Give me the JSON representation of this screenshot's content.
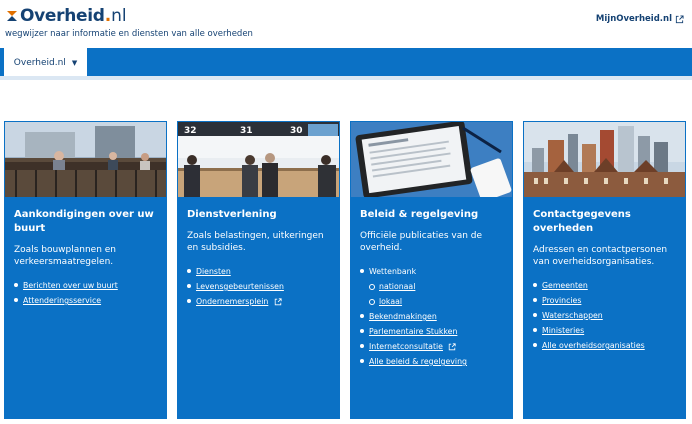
{
  "header": {
    "logo_name": "Overheid",
    "logo_dot": ".",
    "logo_tld": "nl",
    "tagline": "wegwijzer naar informatie en diensten van alle overheden",
    "mijn_link": "MijnOverheid.nl"
  },
  "nav": {
    "tab_label": "Overheid.nl"
  },
  "colors": {
    "brand_blue": "#154273",
    "accent_blue": "#0b71c5",
    "logo_orange": "#e17000"
  },
  "cards": [
    {
      "title": "Aankondigingen over uw buurt",
      "description": "Zoals bouwplannen en verkeersmaatregelen.",
      "links": [
        {
          "label": "Berichten over uw buurt"
        },
        {
          "label": "Attenderingsservice"
        }
      ]
    },
    {
      "title": "Dienstverlening",
      "description": "Zoals belastingen, uitkeringen en subsidies.",
      "links": [
        {
          "label": "Diensten"
        },
        {
          "label": "Levensgebeurtenissen"
        },
        {
          "label": "Ondernemersplein",
          "external": true
        }
      ]
    },
    {
      "title": "Beleid & regelgeving",
      "description": "Officiële publicaties van de overheid.",
      "links": [
        {
          "label": "Wettenbank"
        },
        {
          "label": "nationaal",
          "sub": true
        },
        {
          "label": "lokaal",
          "sub": true
        },
        {
          "label": "Bekendmakingen"
        },
        {
          "label": "Parlementaire Stukken"
        },
        {
          "label": "Internetconsultatie",
          "external": true
        },
        {
          "label": "Alle beleid & regelgeving"
        }
      ]
    },
    {
      "title": "Contactgegevens overheden",
      "description": "Adressen en contactpersonen van overheidsorganisaties.",
      "links": [
        {
          "label": "Gemeenten"
        },
        {
          "label": "Provincies"
        },
        {
          "label": "Waterschappen"
        },
        {
          "label": "Ministeries"
        },
        {
          "label": "Alle overheidsorganisaties"
        }
      ]
    }
  ]
}
